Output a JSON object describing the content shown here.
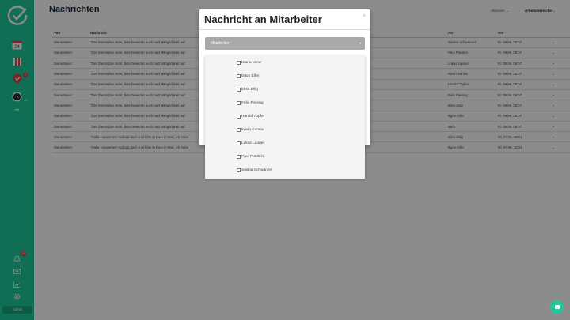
{
  "app": {
    "logo_icon": "clock-check-logo-icon"
  },
  "sidebar": {
    "items": [
      {
        "name": "calendar",
        "label": "24"
      },
      {
        "name": "schedule",
        "label": ""
      },
      {
        "name": "shield",
        "badge": "7"
      },
      {
        "name": "clock",
        "count": "1"
      },
      {
        "name": "more",
        "label": "•••"
      }
    ],
    "bottom": {
      "notifications_badge": "23",
      "admin_label": "Admin"
    }
  },
  "header": {
    "title": "Nachrichten",
    "actions_label": "Aktionen",
    "areas_label": "Arbeitsbereiche"
  },
  "table": {
    "columns": {
      "von": "Von",
      "nachricht": "Nachricht",
      "an": "An",
      "am": "Am"
    },
    "rows": [
      {
        "von": "Diana Meier",
        "nachricht": "\"Der Dienstplan steht, bitte bewertet euch nach Möglichkeit auf",
        "an": "Saskia Schwänzer",
        "am": "Fr. 09.06. 08:57"
      },
      {
        "von": "Diana Meier",
        "nachricht": "\"Der Dienstplan steht, bitte bewertet euch nach Möglichkeit auf",
        "an": "Paul Püntlich",
        "am": "Fr. 09.06. 08:57"
      },
      {
        "von": "Diana Meier",
        "nachricht": "\"Der Dienstplan steht, bitte bewertet euch nach Möglichkeit auf",
        "an": "Lukas Launer",
        "am": "Fr. 09.06. 08:57"
      },
      {
        "von": "Diana Meier",
        "nachricht": "\"Der Dienstplan steht, bitte bewertet euch nach Möglichkeit auf",
        "an": "Kevin Kannix",
        "am": "Fr. 09.06. 08:57"
      },
      {
        "von": "Diana Meier",
        "nachricht": "\"Der Dienstplan steht, bitte bewertet euch nach Möglichkeit auf",
        "an": "Harald Töpfer",
        "am": "Fr. 09.06. 08:57"
      },
      {
        "von": "Diana Meier",
        "nachricht": "\"Der Dienstplan steht, bitte bewertet euch nach Möglichkeit auf",
        "an": "Felix Fleissig",
        "am": "Fr. 09.06. 08:57"
      },
      {
        "von": "Diana Meier",
        "nachricht": "\"Der Dienstplan steht, bitte bewertet euch nach Möglichkeit auf",
        "an": "Elisa Eilig",
        "am": "Fr. 09.06. 08:57"
      },
      {
        "von": "Diana Meier",
        "nachricht": "\"Der Dienstplan steht, bitte bewertet euch nach Möglichkeit auf",
        "an": "Egon Eifer",
        "am": "Fr. 09.06. 08:57"
      },
      {
        "von": "Diana Meier",
        "nachricht": "\"Der Dienstplan steht, bitte bewertet euch nach Möglichkeit auf",
        "an": "Mich",
        "am": "Fr. 09.06. 08:57"
      },
      {
        "von": "Diana Meier",
        "nachricht": "\"Hallo zusammen! Schaut doch mal bitte in Eure E-Mail, ich habe",
        "an": "Elisa Eilig",
        "am": "Mi. 07.06. 10:01"
      },
      {
        "von": "Diana Meier",
        "nachricht": "\"Hallo zusammen! Schaut doch mal bitte in Eure E-Mail, ich habe",
        "an": "Egon Eifer",
        "am": "Mi. 07.06. 10:01"
      }
    ]
  },
  "modal": {
    "title": "Nachricht an Mitarbeiter",
    "close": "×",
    "select_placeholder": "Mitarbeiter",
    "options": [
      "Diana Meier",
      "Egon Eifer",
      "Elisa Eilig",
      "Felix Fleissig",
      "Harald Töpfer",
      "Kevin Kannix",
      "Lukas Launer",
      "Paul Püntlich",
      "Saskia Schwänzer"
    ]
  },
  "colors": {
    "accent": "#1ec99a",
    "badge": "#e8413f",
    "select_bg": "#a9a9a9"
  }
}
